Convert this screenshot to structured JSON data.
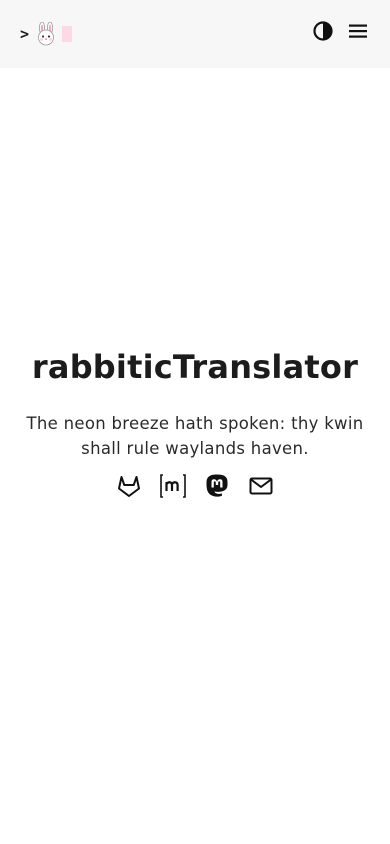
{
  "header": {
    "prompt": ">",
    "bunny_icon": "bunny-face-icon",
    "theme_toggle_icon": "contrast-icon",
    "menu_icon": "hamburger-menu-icon",
    "cursor_color": "#fcd9e3"
  },
  "hero": {
    "title": "rabbiticTranslator",
    "tagline": "The neon breeze hath spoken: thy kwin shall rule waylands haven."
  },
  "socials": [
    {
      "icon": "gitlab-icon"
    },
    {
      "icon": "matrix-icon"
    },
    {
      "icon": "mastodon-icon"
    },
    {
      "icon": "email-icon"
    }
  ],
  "colors": {
    "header_bg": "#f7f7f7",
    "text": "#1c1c1c",
    "accent_pink": "#fcd9e3"
  }
}
